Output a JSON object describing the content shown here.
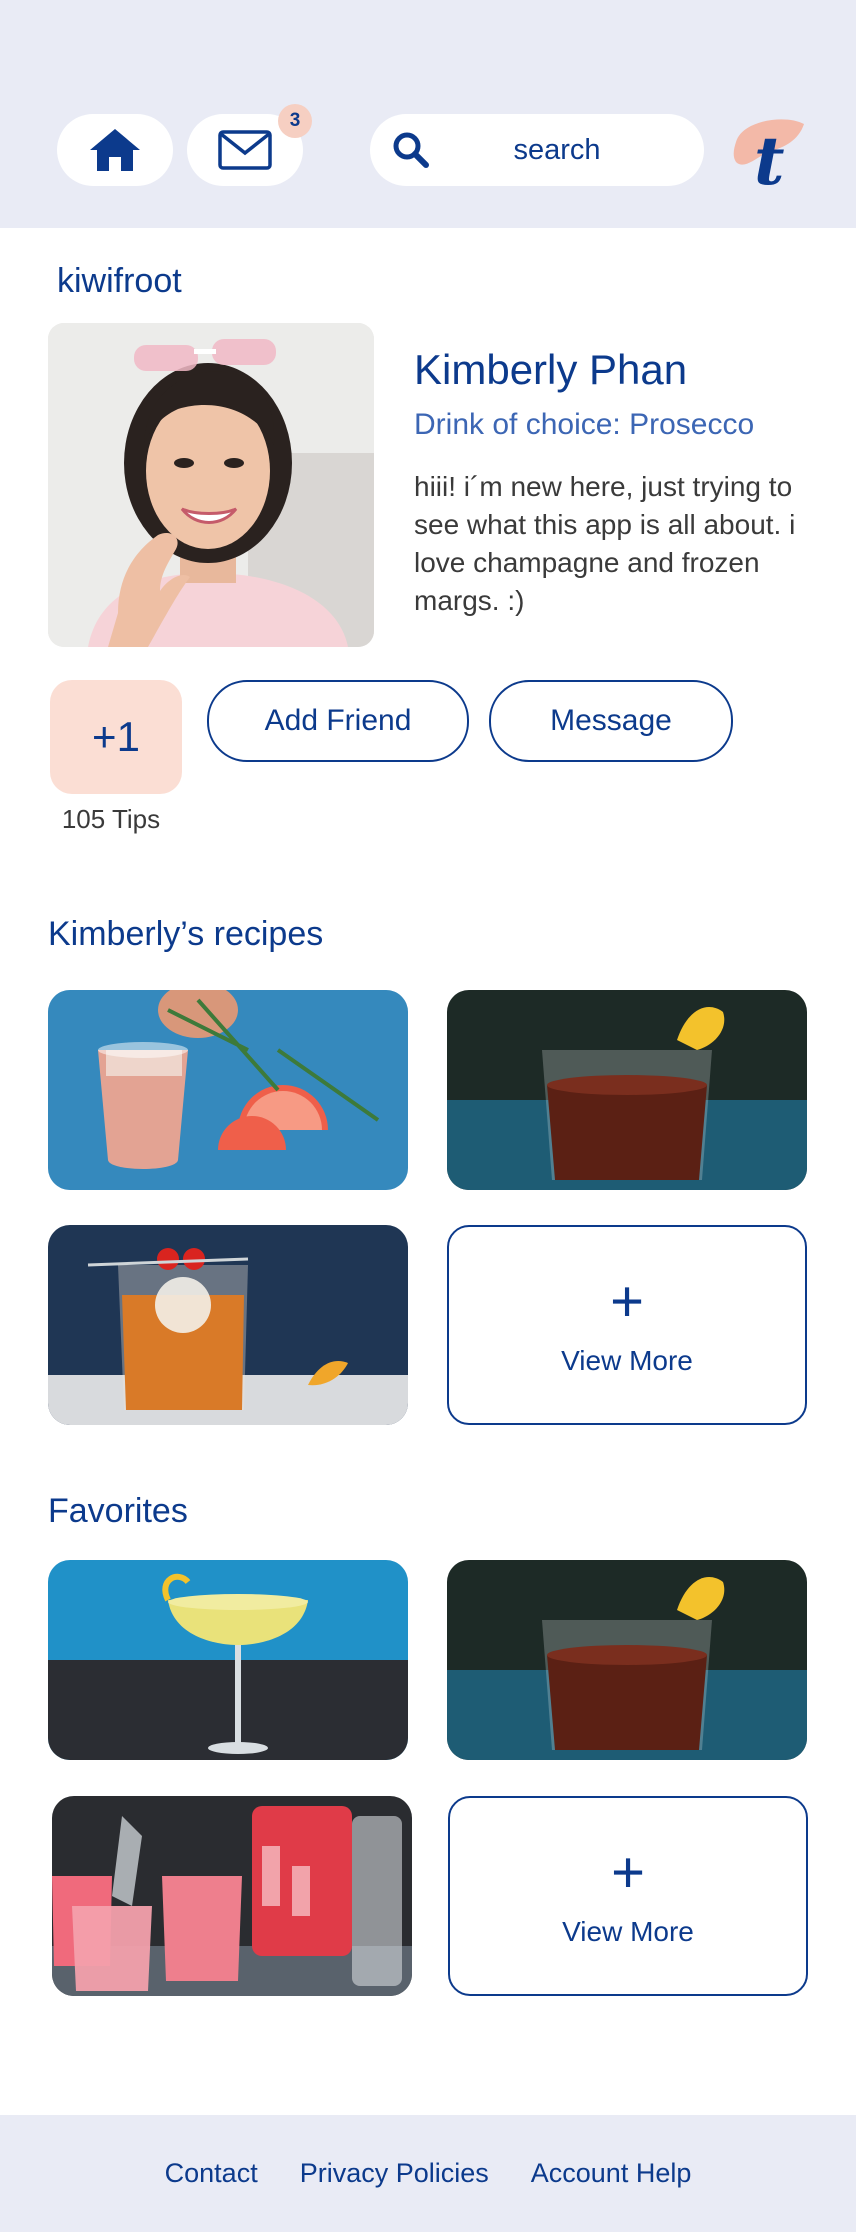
{
  "header": {
    "notification_count": "3",
    "search_placeholder": "search",
    "logo_letter": "t"
  },
  "profile": {
    "username": "kiwifroot",
    "full_name": "Kimberly Phan",
    "drink_of_choice": "Drink of choice: Prosecco",
    "bio": "hiii! i´m new here, just trying to see what this app is all about. i love champagne and frozen margs. :)",
    "plus_one_label": "+1",
    "tips_label": "105 Tips",
    "add_friend_label": "Add Friend",
    "message_label": "Message"
  },
  "recipes": {
    "title": "Kimberly’s recipes",
    "view_more_label": "View More"
  },
  "favorites": {
    "title": "Favorites",
    "view_more_label": "View More"
  },
  "footer": {
    "links": [
      "Contact",
      "Privacy Policies",
      "Account Help"
    ]
  },
  "colors": {
    "primary": "#0c3a8c",
    "header_bg": "#e9ebf5",
    "accent_peach": "#fbded4"
  }
}
